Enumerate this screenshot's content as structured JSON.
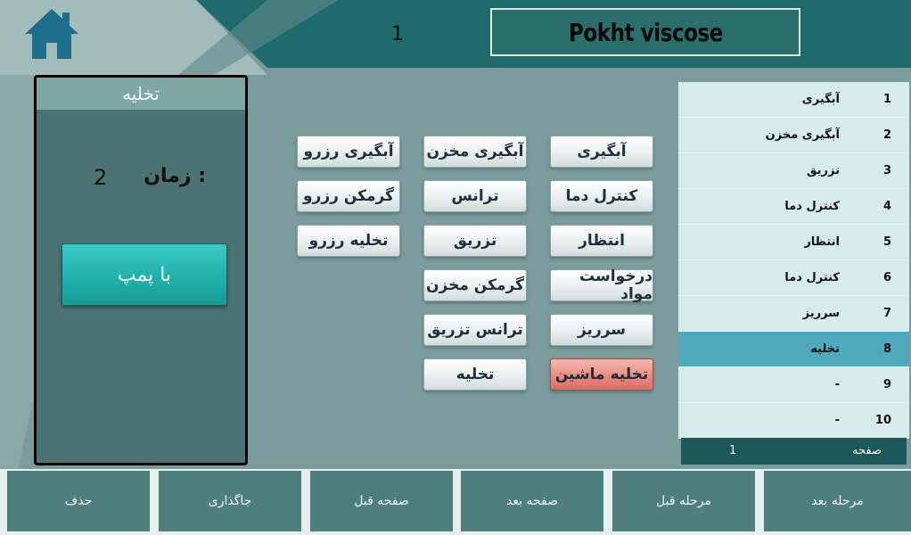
{
  "header": {
    "page_number": "1",
    "title": "Pokht viscose"
  },
  "icons": {
    "home": "home-icon"
  },
  "colors": {
    "header_bg": "#1f6a6c",
    "panel_bg": "#4a7372",
    "pump_button": "#20b3ad",
    "selected_row": "#4da9bb",
    "alert_button": "#e98c80"
  },
  "left_panel": {
    "title": "تخلیه",
    "time_label": "زمان :",
    "time_value": "2",
    "pump_button": "با پمپ"
  },
  "steps": {
    "col_right": [
      "آبگیری",
      "کنترل دما",
      "انتظار",
      "درخواست مواد",
      "سرریز",
      "تخلیه ماشین"
    ],
    "col_middle": [
      "آبگیری مخزن",
      "ترانس",
      "تزریق",
      "گرمکن مخزن",
      "ترانس تزریق",
      "تخلیه"
    ],
    "col_left": [
      "آبگیری رزرو",
      "گرمکن رزرو",
      "تخلیه رزرو"
    ]
  },
  "sequence": {
    "rows": [
      {
        "num": "1",
        "name": "آبگیری"
      },
      {
        "num": "2",
        "name": "آبگیری مخزن"
      },
      {
        "num": "3",
        "name": "تزریق"
      },
      {
        "num": "4",
        "name": "کنترل دما"
      },
      {
        "num": "5",
        "name": "انتظار"
      },
      {
        "num": "6",
        "name": "کنترل دما"
      },
      {
        "num": "7",
        "name": "سرریز"
      },
      {
        "num": "8",
        "name": "تخلیه"
      },
      {
        "num": "9",
        "name": "-"
      },
      {
        "num": "10",
        "name": "-"
      }
    ],
    "selected_index": 7,
    "footer_label": "صفحه",
    "footer_value": "1"
  },
  "bottom_bar": {
    "delete": "حذف",
    "insert": "جاگذاری",
    "prev_page": "صفحه قبل",
    "next_page": "صفحه بعد",
    "prev_step": "مرحله قبل",
    "next_step": "مرحله بعد"
  }
}
